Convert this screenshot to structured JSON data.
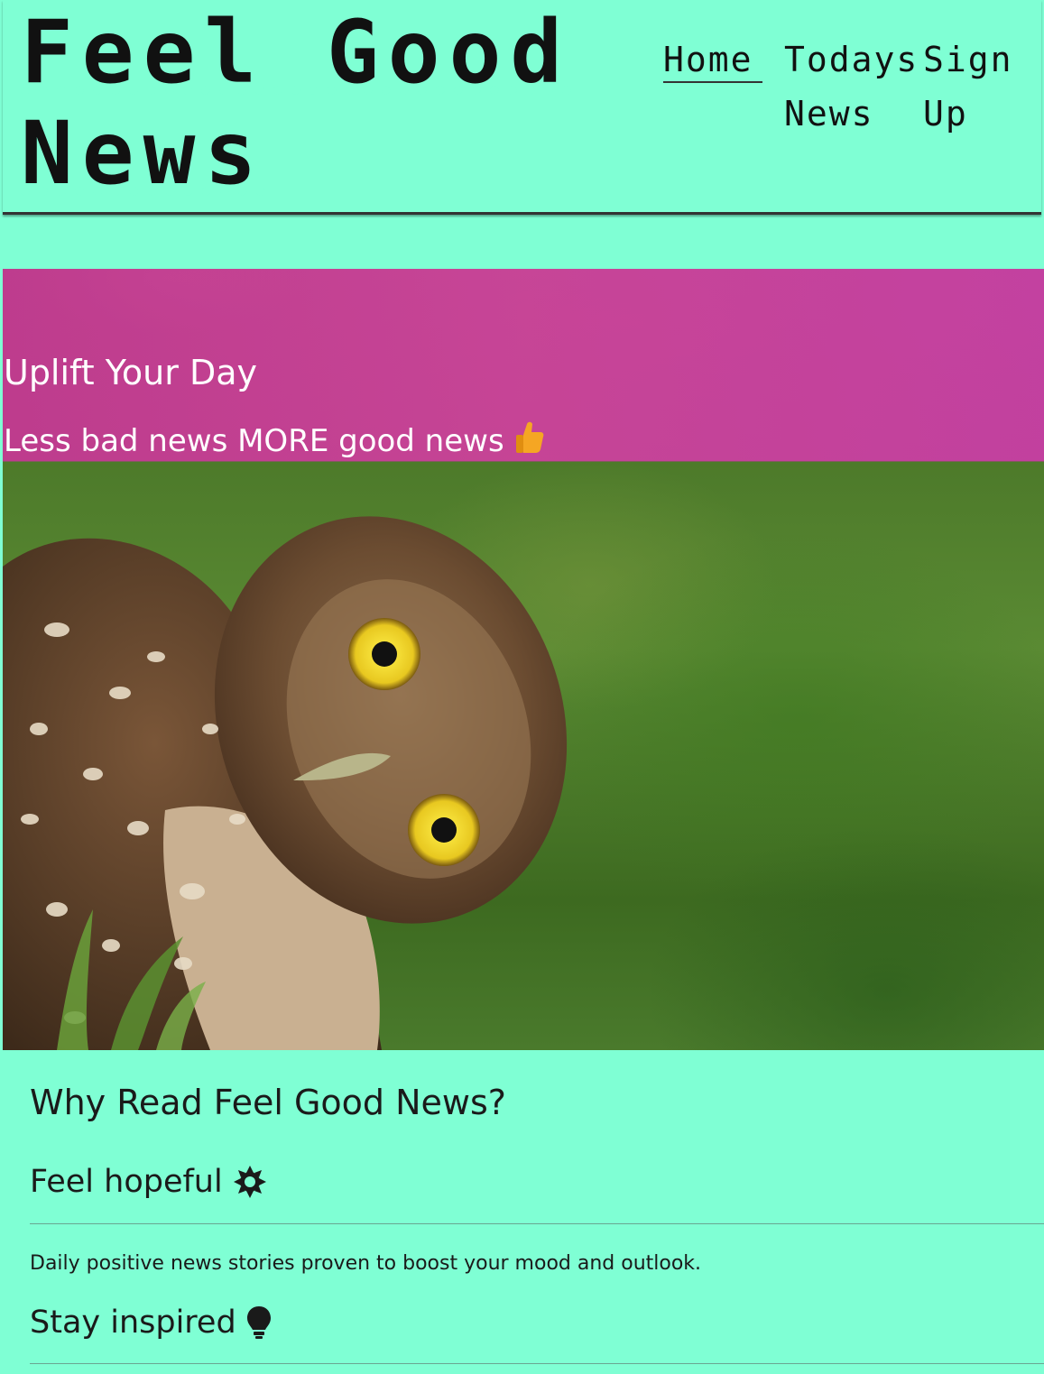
{
  "header": {
    "logo": "Feel Good News",
    "nav": [
      {
        "label": "Home",
        "active": true
      },
      {
        "label": "Todays News",
        "active": false
      },
      {
        "label": "Sign Up",
        "active": false
      }
    ]
  },
  "hero": {
    "title": "Uplift Your Day",
    "subtitle": "Less bad news MORE good news",
    "subtitle_icon": "thumbs-up-icon",
    "image": "owl-photo"
  },
  "why": {
    "title": "Why Read Feel Good News?",
    "features": [
      {
        "title": "Feel hopeful",
        "icon": "sun-icon",
        "text": "Daily positive news stories proven to boost your mood and outlook."
      },
      {
        "title": "Stay inspired",
        "icon": "lightbulb-icon",
        "text": ""
      }
    ]
  },
  "colors": {
    "background": "#7fffd4",
    "text": "#1a1a1a",
    "hero_text": "#ffffff"
  }
}
